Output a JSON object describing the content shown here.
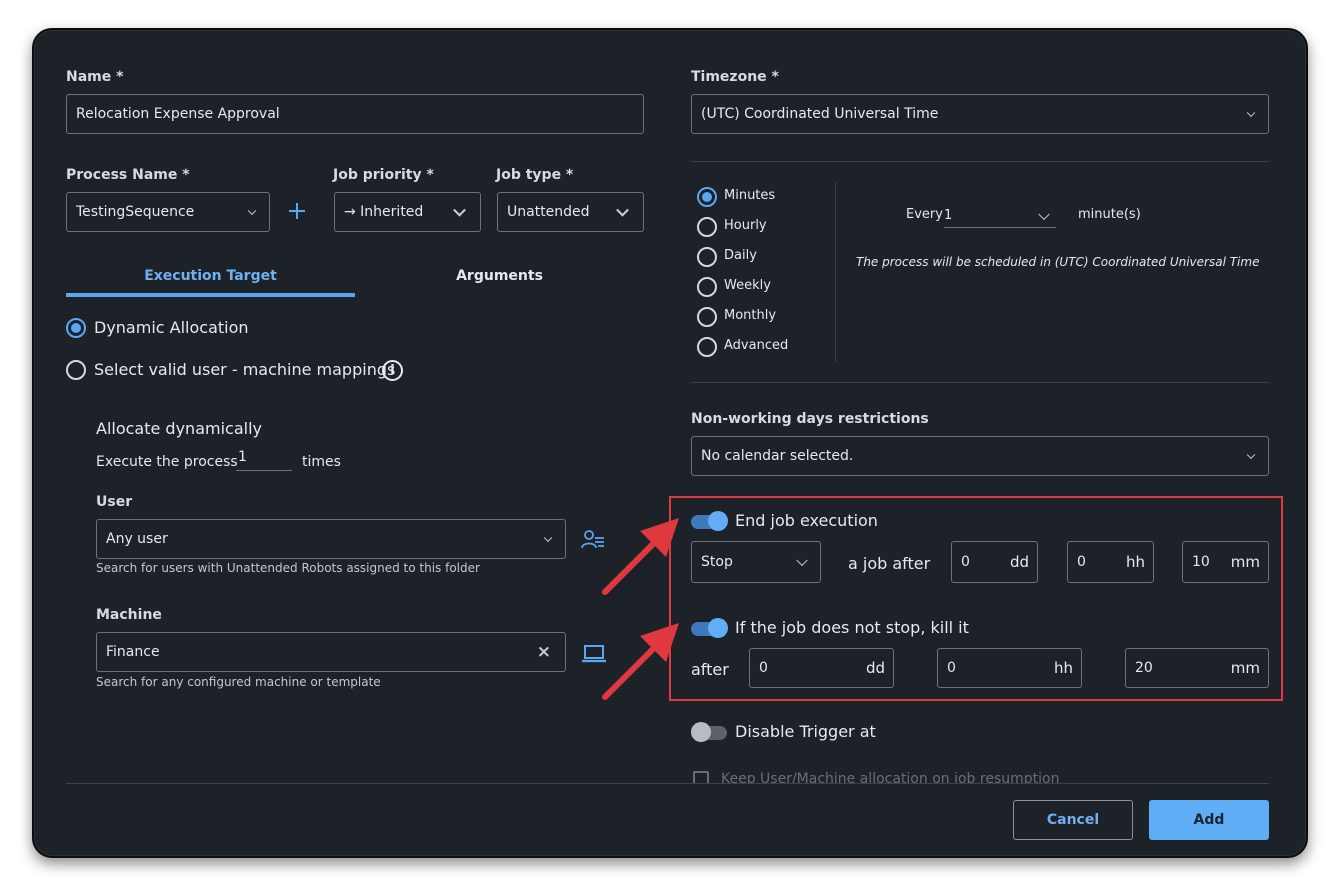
{
  "form": {
    "name": {
      "label": "Name *",
      "value": "Relocation Expense Approval"
    },
    "process_name": {
      "label": "Process Name *",
      "value": "TestingSequence"
    },
    "job_priority": {
      "label": "Job priority *",
      "value": "→ Inherited"
    },
    "job_type": {
      "label": "Job type *",
      "value": "Unattended"
    },
    "timezone": {
      "label": "Timezone *",
      "value": "(UTC) Coordinated Universal Time"
    }
  },
  "tabs": [
    {
      "label": "Execution Target",
      "active": true
    },
    {
      "label": "Arguments",
      "active": false
    }
  ],
  "execution_target": {
    "options": [
      {
        "label": "Dynamic Allocation",
        "selected": true
      },
      {
        "label": "Select valid user - machine mappings",
        "selected": false
      }
    ],
    "allocate_title": "Allocate dynamically",
    "execute_prefix": "Execute the process",
    "execute_count": "1",
    "execute_suffix": "times",
    "user": {
      "label": "User",
      "value": "Any user",
      "hint": "Search for users with Unattended Robots assigned to this folder"
    },
    "machine": {
      "label": "Machine",
      "value": "Finance",
      "hint": "Search for any configured machine or template"
    }
  },
  "schedule": {
    "frequencies": [
      {
        "label": "Minutes",
        "selected": true
      },
      {
        "label": "Hourly",
        "selected": false
      },
      {
        "label": "Daily",
        "selected": false
      },
      {
        "label": "Weekly",
        "selected": false
      },
      {
        "label": "Monthly",
        "selected": false
      },
      {
        "label": "Advanced",
        "selected": false
      }
    ],
    "every_label": "Every",
    "every_value": "1",
    "unit_label": "minute(s)",
    "note": "The process will be scheduled in (UTC) Coordinated Universal Time"
  },
  "non_working": {
    "label": "Non-working days restrictions",
    "value": "No calendar selected."
  },
  "end_job": {
    "toggle_label": "End job execution",
    "toggle_on": true,
    "action": "Stop",
    "after_text": "a job after",
    "dd": "0",
    "hh": "0",
    "mm": "10"
  },
  "kill_job": {
    "toggle_label": "If the job does not stop, kill it",
    "toggle_on": true,
    "after_text": "after",
    "dd": "0",
    "hh": "0",
    "mm": "20"
  },
  "units": {
    "dd": "dd",
    "hh": "hh",
    "mm": "mm"
  },
  "disable_trigger": {
    "label": "Disable Trigger at",
    "on": false
  },
  "keep_allocation": {
    "label": "Keep User/Machine allocation on job resumption"
  },
  "buttons": {
    "cancel": "Cancel",
    "add": "Add"
  },
  "colors": {
    "accent": "#5aa6f2",
    "annotation": "#e0383f",
    "background": "#1d2229"
  },
  "icons": {
    "add": "plus-icon",
    "info": "info-icon",
    "user_picker": "user-group-icon",
    "machine_picker": "laptop-icon",
    "clear": "close-icon",
    "annotation": "arrow-annotation-icon"
  }
}
